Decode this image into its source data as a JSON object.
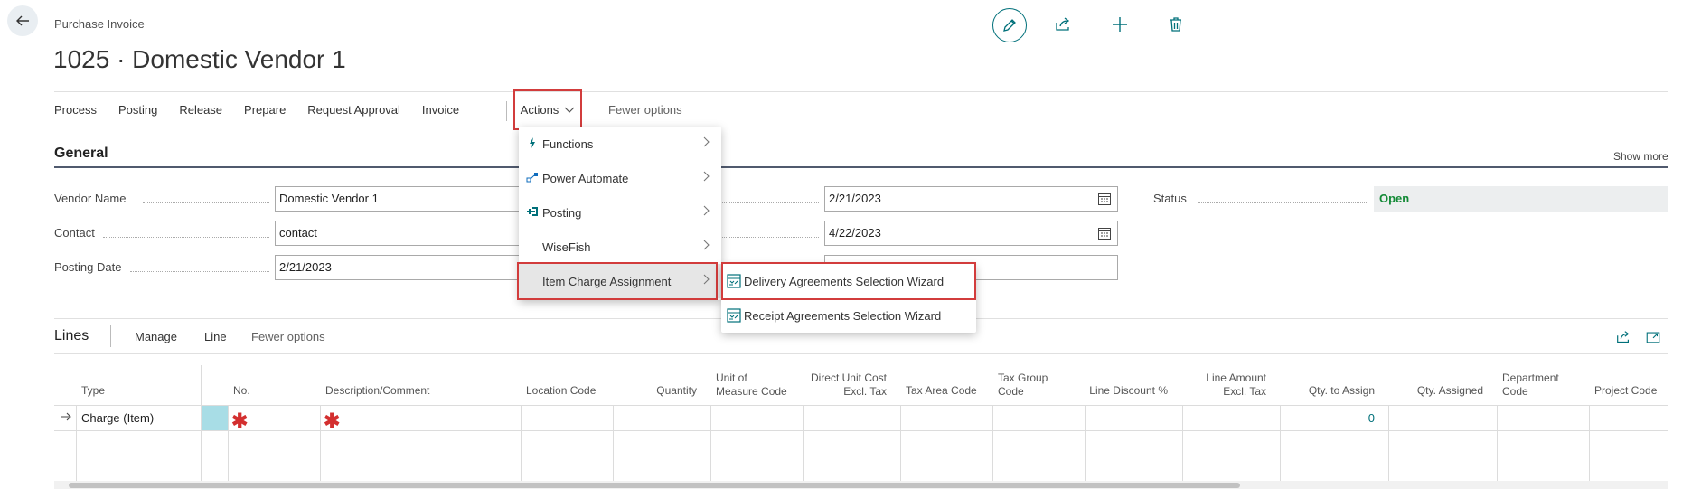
{
  "header": {
    "subtitle": "Purchase Invoice",
    "title": "1025 · Domestic Vendor 1"
  },
  "icons": {
    "back": "back-arrow-icon",
    "edit": "pencil-icon",
    "share": "share-icon",
    "new": "plus-icon",
    "delete": "trash-icon"
  },
  "actionbar": {
    "items": [
      "Process",
      "Posting",
      "Release",
      "Prepare",
      "Request Approval",
      "Invoice"
    ],
    "actions_label": "Actions",
    "fewer_label": "Fewer options"
  },
  "actions_menu": {
    "items": [
      {
        "label": "Functions",
        "icon": "lightning-icon"
      },
      {
        "label": "Power Automate",
        "icon": "flow-icon"
      },
      {
        "label": "Posting",
        "icon": "post-icon"
      },
      {
        "label": "WiseFish",
        "icon": ""
      },
      {
        "label": "Item Charge Assignment",
        "icon": ""
      }
    ]
  },
  "submenu": {
    "items": [
      {
        "label": "Delivery Agreements Selection Wizard",
        "icon": "wizard-icon"
      },
      {
        "label": "Receipt Agreements Selection Wizard",
        "icon": "wizard-icon"
      }
    ]
  },
  "general": {
    "title": "General",
    "show_more": "Show more",
    "vendor_name_label": "Vendor Name",
    "vendor_name_value": "Domestic Vendor 1",
    "contact_label": "Contact",
    "contact_value": "contact",
    "posting_date_label": "Posting Date",
    "posting_date_value": "2/21/2023",
    "date1_value": "2/21/2023",
    "date2_value": "4/22/2023",
    "date3_value": "",
    "status_label": "Status",
    "status_value": "Open",
    "status_color": "#138a36"
  },
  "lines": {
    "title": "Lines",
    "actions": [
      "Manage",
      "Line",
      "Fewer options"
    ],
    "columns": [
      {
        "label": "Type",
        "label2": ""
      },
      {
        "label": "No.",
        "label2": ""
      },
      {
        "label": "Description/Comment",
        "label2": ""
      },
      {
        "label": "Location Code",
        "label2": ""
      },
      {
        "label": "Quantity",
        "label2": ""
      },
      {
        "label": "Unit of",
        "label2": "Measure Code"
      },
      {
        "label": "Direct Unit Cost",
        "label2": "Excl. Tax"
      },
      {
        "label": "Tax Area Code",
        "label2": ""
      },
      {
        "label": "Tax Group",
        "label2": "Code"
      },
      {
        "label": "Line Discount %",
        "label2": ""
      },
      {
        "label": "Line Amount",
        "label2": "Excl. Tax"
      },
      {
        "label": "Qty. to Assign",
        "label2": ""
      },
      {
        "label": "Qty. Assigned",
        "label2": ""
      },
      {
        "label": "Department",
        "label2": "Code"
      },
      {
        "label": "Project Code",
        "label2": ""
      }
    ],
    "row1": {
      "type": "Charge (Item)",
      "qty_to_assign": "0"
    }
  },
  "colors": {
    "accent": "#00707a",
    "highlight_border": "#d23c3c",
    "required": "#d32f2f"
  }
}
